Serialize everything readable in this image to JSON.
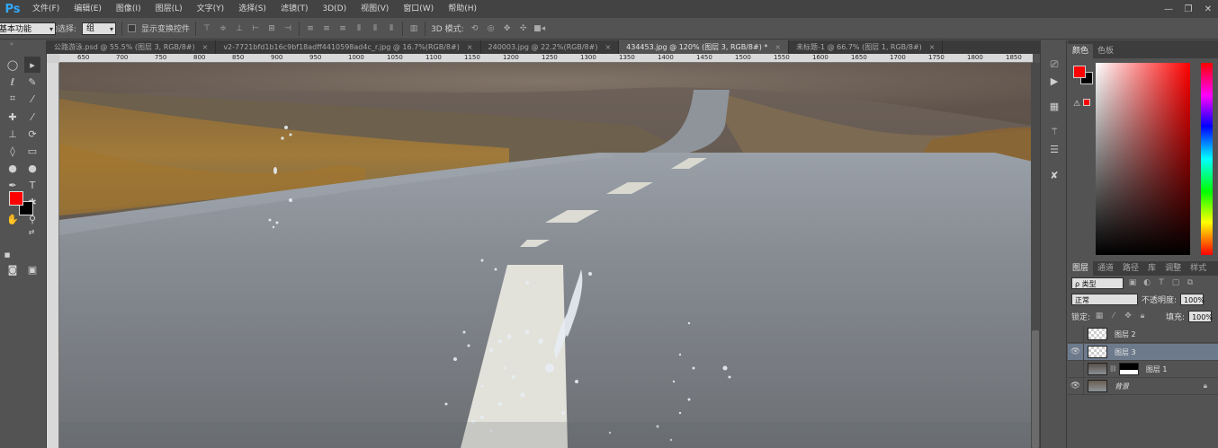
{
  "app": {
    "logo": "Ps"
  },
  "menu": [
    "文件(F)",
    "编辑(E)",
    "图像(I)",
    "图层(L)",
    "文字(Y)",
    "选择(S)",
    "滤镜(T)",
    "3D(D)",
    "视图(V)",
    "窗口(W)",
    "帮助(H)"
  ],
  "window_controls": [
    "—",
    "❐",
    "✕"
  ],
  "options": {
    "auto_select_label": "自动选择:",
    "auto_select_value": "组",
    "show_transform_label": "显示变换控件",
    "mode_3d_label": "3D 模式:",
    "workspace": "基本功能"
  },
  "tabs": [
    {
      "label": "公路游泳.psd @ 55.5% (图层 3, RGB/8#)",
      "active": false
    },
    {
      "label": "v2-7721bfd1b16c9bf18adff4410598ad4c_r.jpg @ 16.7%(RGB/8#)",
      "active": false
    },
    {
      "label": "240003.jpg @ 22.2%(RGB/8#)",
      "active": false
    },
    {
      "label": "434453.jpg @ 120% (图层 3, RGB/8#) *",
      "active": true
    },
    {
      "label": "未标题-1 @ 66.7% (图层 1, RGB/8#)",
      "active": false
    }
  ],
  "tab_close": "×",
  "ruler_h_ticks": [
    "650",
    "700",
    "750",
    "800",
    "850",
    "900",
    "950",
    "1000",
    "1050",
    "1100",
    "1150",
    "1200",
    "1250",
    "1300",
    "1350",
    "1400",
    "1450",
    "1500",
    "1550",
    "1600",
    "1650",
    "1700",
    "1750",
    "1800",
    "1850"
  ],
  "color_panel": {
    "tabs": [
      "颜色",
      "色板"
    ],
    "gamut_icon": "⚠"
  },
  "layers_panel": {
    "tabs": [
      "图层",
      "通道",
      "路径",
      "库",
      "调整",
      "样式"
    ],
    "filter_label": "ρ 类型",
    "blend_mode": "正常",
    "opacity_label": "不透明度:",
    "opacity_value": "100%",
    "lock_label": "锁定:",
    "fill_label": "填充:",
    "fill_value": "100%",
    "layers": [
      {
        "name": "图层 2",
        "visible": false,
        "selected": false
      },
      {
        "name": "图层 3",
        "visible": true,
        "selected": true
      },
      {
        "name": "图层 1",
        "visible": false,
        "selected": false
      },
      {
        "name": "背景",
        "visible": true,
        "selected": false
      }
    ]
  },
  "colors": {
    "foreground": "#ff0000",
    "background": "#000000",
    "accent": "#31a8ff"
  }
}
